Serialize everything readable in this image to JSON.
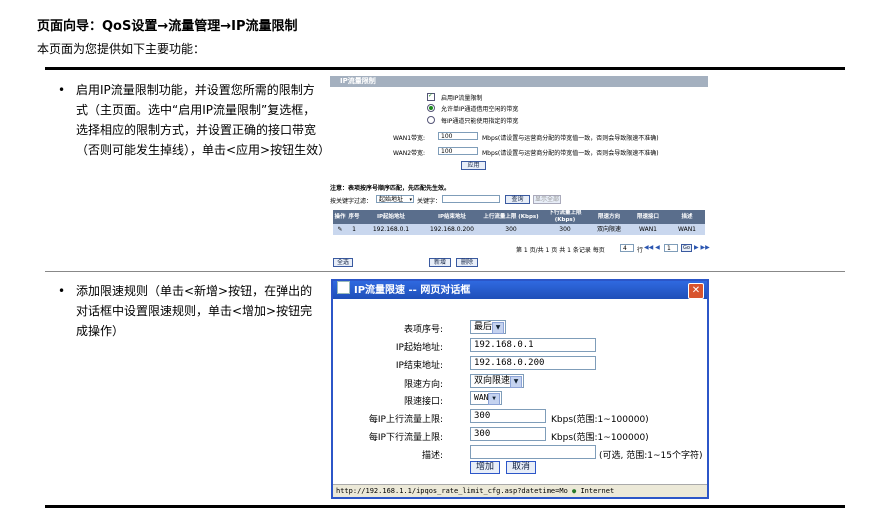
{
  "page": {
    "title": "页面向导：QoS设置→流量管理→IP流量限制",
    "subtitle": "本页面为您提供如下主要功能："
  },
  "bullets": [
    "启用IP流量限制功能，并设置您所需的限制方式（主页面。选中“启用IP流量限制”复选框，选择相应的限制方式，并设置正确的接口带宽（否则可能发生掉线），单击<应用>按钮生效）",
    "添加限速规则（单击<新增>按钮，在弹出的对话框中设置限速规则，单击<增加>按钮完成操作）"
  ],
  "main_panel": {
    "header": "IP流量限制",
    "enable_label": "启用IP流量限制",
    "opt1": "允许单IP通道借用空闲的带宽",
    "opt2": "每IP通道只能使用指定的带宽",
    "wan1_label": "WAN1带宽:",
    "wan1_value": "100",
    "wan1_hint": "Mbps(请设置与运营商分配的带宽值一致，否则会导致限速不准确)",
    "wan2_label": "WAN2带宽:",
    "wan2_value": "100",
    "wan2_hint": "Mbps(请设置与运营商分配的带宽值一致，否则会导致限速不准确)",
    "apply": "应用",
    "note": "注意：表项按序号顺序匹配，先匹配先生效。",
    "filter_label": "按关键字过滤：",
    "filter_select": "起始地址",
    "keyword_label": "关键字：",
    "search": "查询",
    "show_all": "显示全部",
    "columns": [
      "操作",
      "序号",
      "IP起始地址",
      "IP结束地址",
      "上行流量上限 (Kbps)",
      "下行流量上限 (Kbps)",
      "限速方向",
      "限速接口",
      "描述"
    ],
    "row": [
      "✎",
      "1",
      "192.168.0.1",
      "192.168.0.200",
      "300",
      "300",
      "双向限速",
      "WAN1",
      "WAN1"
    ],
    "pager": "第 1 页/共 1 页 共 1 条记录 每页",
    "per_page": "4",
    "pager_mid": "行",
    "page_num": "1",
    "go": "Go",
    "select_all": "全选",
    "add": "新增",
    "delete": "删除"
  },
  "dialog": {
    "title": "IP流量限速 -- 网页对话框",
    "index_label": "表项序号:",
    "index_value": "最后",
    "start_label": "IP起始地址:",
    "start_value": "192.168.0.1",
    "end_label": "IP结束地址:",
    "end_value": "192.168.0.200",
    "dir_label": "限速方向:",
    "dir_value": "双向限速",
    "iface_label": "限速接口:",
    "iface_value": "WAN1",
    "up_label": "每IP上行流量上限:",
    "up_value": "300",
    "up_hint": "Kbps(范围:1~100000)",
    "down_label": "每IP下行流量上限:",
    "down_value": "300",
    "down_hint": "Kbps(范围:1~100000)",
    "desc_label": "描述:",
    "desc_value": "",
    "desc_hint": "(可选, 范围:1~15个字符)",
    "add": "增加",
    "cancel": "取消",
    "status": "http://192.168.1.1/ipqos_rate_limit_cfg.asp?datetime=Mo",
    "status_zone": "Internet"
  }
}
